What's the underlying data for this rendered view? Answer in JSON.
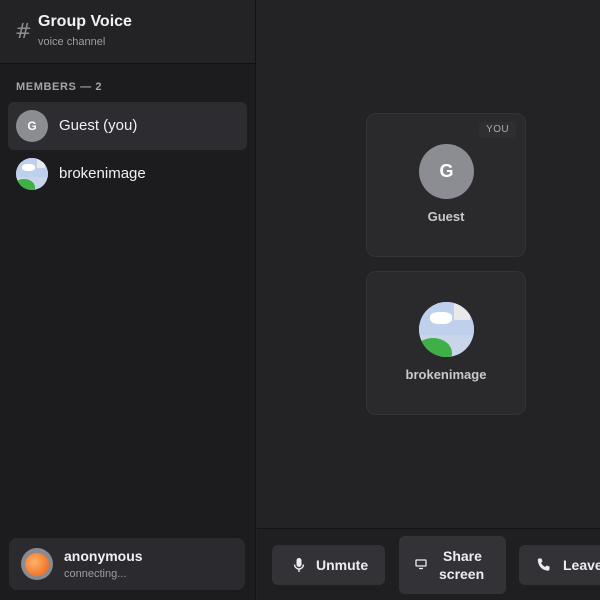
{
  "channel": {
    "hash": "#",
    "title": "Group Voice",
    "subtitle": "voice channel"
  },
  "members": {
    "label": "MEMBERS — 2",
    "items": [
      {
        "name": "Guest (you)",
        "avatar_letter": "G",
        "selected": true
      },
      {
        "name": "brokenimage",
        "avatar": "broken-image-icon",
        "selected": false
      }
    ]
  },
  "user_panel": {
    "name": "anonymous",
    "status": "connecting..."
  },
  "stage": {
    "tiles": [
      {
        "name": "Guest",
        "avatar_letter": "G",
        "badge": "YOU"
      },
      {
        "name": "brokenimage",
        "avatar": "broken-image-icon"
      }
    ]
  },
  "controls": {
    "unmute": "Unmute",
    "share_line1": "Share",
    "share_line2": "screen",
    "leave": "Leave"
  },
  "colors": {
    "background": "#232326",
    "sidebar": "#1c1c1f",
    "button": "#333337",
    "avatar_grey": "#8c8c93"
  }
}
